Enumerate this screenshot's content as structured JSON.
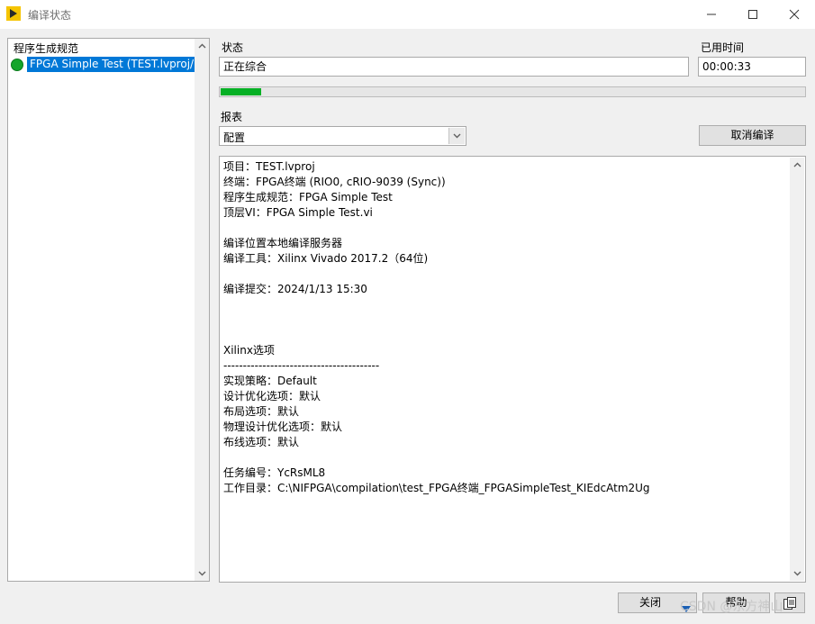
{
  "window": {
    "title": "编译状态",
    "icon": "labview-arrow-icon"
  },
  "sidebar": {
    "header": "程序生成规范",
    "items": [
      {
        "label": "FPGA Simple Test (TEST.lvproj/FPGA终端)",
        "status": "success",
        "status_color": "#15a52b"
      }
    ]
  },
  "status": {
    "label": "状态",
    "value": "正在综合"
  },
  "elapsed": {
    "label": "已用时间",
    "value": "00:00:33"
  },
  "progress": {
    "fraction": 0.07,
    "color": "#06b025"
  },
  "reports": {
    "label": "报表",
    "selected": "配置"
  },
  "cancel_button": "取消编译",
  "report_text": [
    "项目：TEST.lvproj",
    "终端：FPGA终端 (RIO0, cRIO-9039 (Sync))",
    "程序生成规范：FPGA Simple Test",
    "顶层VI：FPGA Simple Test.vi",
    "",
    "编译位置本地编译服务器",
    "编译工具：Xilinx Vivado 2017.2（64位)",
    "",
    "编译提交：2024/1/13 15:30",
    "",
    "",
    "",
    "Xilinx选项",
    "----------------------------------------",
    "实现策略：Default",
    "设计优化选项：默认",
    "布局选项：默认",
    "物理设计优化选项：默认",
    "布线选项：默认",
    "",
    "任务编号：YcRsML8",
    "工作目录：C:\\NIFPGA\\compilation\\test_FPGA终端_FPGASimpleTest_KIEdcAtm2Ug"
  ],
  "footer": {
    "close_label": "关闭",
    "help_label": "帮助"
  },
  "watermark": "CSDN @东方神山"
}
